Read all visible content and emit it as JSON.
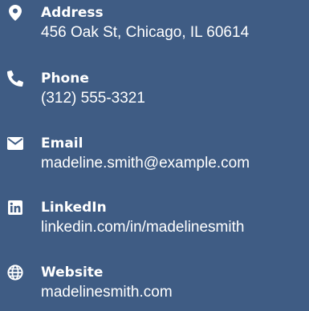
{
  "contact": {
    "items": [
      {
        "icon": "location-pin-icon",
        "label": "Address",
        "value": "456 Oak St, Chicago, IL 60614"
      },
      {
        "icon": "phone-icon",
        "label": "Phone",
        "value": "(312) 555-3321"
      },
      {
        "icon": "envelope-icon",
        "label": "Email",
        "value": "madeline.smith@example.com"
      },
      {
        "icon": "linkedin-icon",
        "label": "LinkedIn",
        "value": "linkedin.com/in/madelinesmith"
      },
      {
        "icon": "globe-icon",
        "label": "Website",
        "value": "madelinesmith.com"
      }
    ]
  },
  "colors": {
    "background": "#3f5c84",
    "text": "#ffffff"
  }
}
